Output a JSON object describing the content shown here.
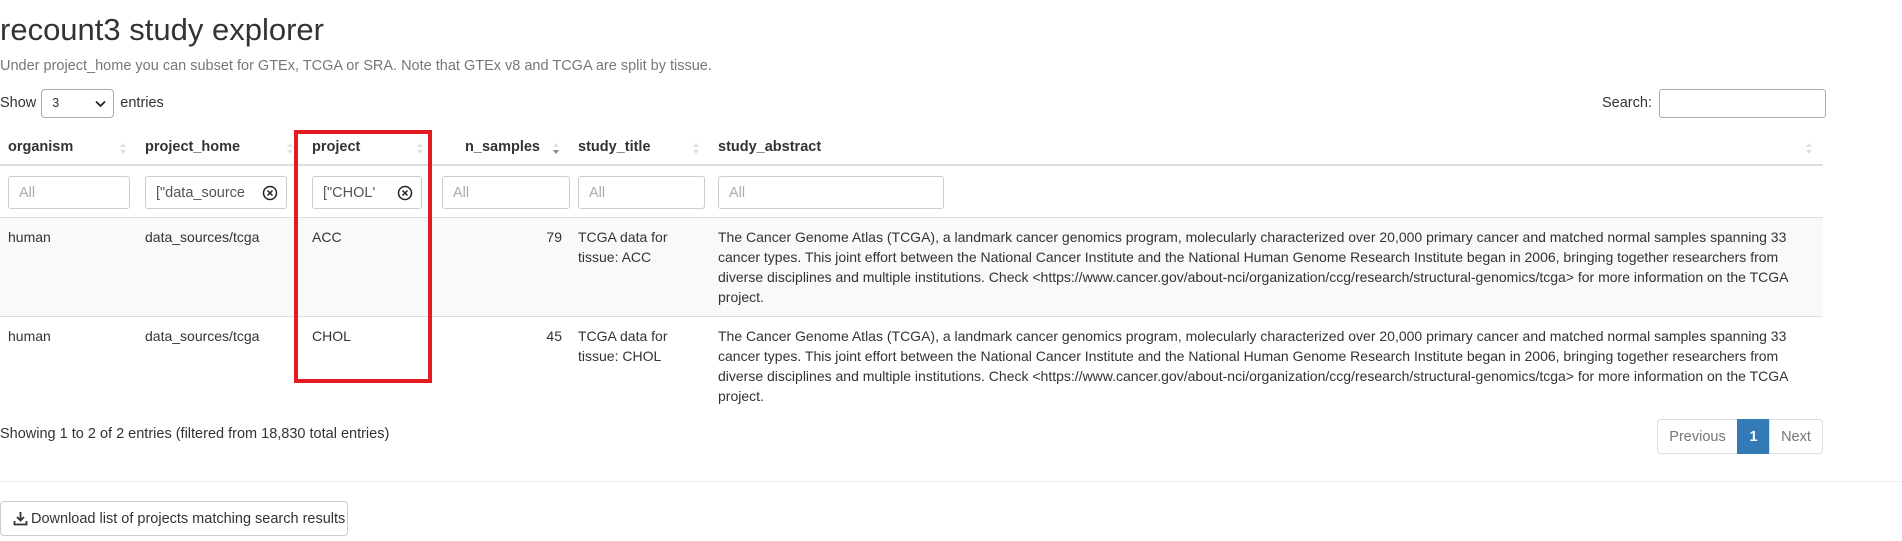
{
  "page": {
    "title": "recount3 study explorer",
    "subtitle": "Under project_home you can subset for GTEx, TCGA or SRA. Note that GTEx v8 and TCGA are split by tissue."
  },
  "length_control": {
    "show_label": "Show",
    "selected_value": "3",
    "entries_label": "entries"
  },
  "search": {
    "label": "Search:",
    "value": ""
  },
  "table": {
    "columns": [
      "organism",
      "project_home",
      "project",
      "n_samples",
      "study_title",
      "study_abstract"
    ],
    "filters": [
      {
        "value": "",
        "placeholder": "All"
      },
      {
        "value": "[\"data_source",
        "placeholder": "All"
      },
      {
        "value": "[\"CHOL'",
        "placeholder": "All"
      },
      {
        "value": "",
        "placeholder": "All"
      },
      {
        "value": "",
        "placeholder": "All"
      },
      {
        "value": "",
        "placeholder": "All"
      }
    ],
    "rows": [
      {
        "organism": "human",
        "project_home": "data_sources/tcga",
        "project": "ACC",
        "n_samples": "79",
        "study_title": "TCGA data for tissue: ACC",
        "study_abstract": "The Cancer Genome Atlas (TCGA), a landmark cancer genomics program, molecularly characterized over 20,000 primary cancer and matched normal samples spanning 33 cancer types. This joint effort between the National Cancer Institute and the National Human Genome Research Institute began in 2006, bringing together researchers from diverse disciplines and multiple institutions. Check <https://www.cancer.gov/about-nci/organization/ccg/research/structural-genomics/tcga> for more information on the TCGA project."
      },
      {
        "organism": "human",
        "project_home": "data_sources/tcga",
        "project": "CHOL",
        "n_samples": "45",
        "study_title": "TCGA data for tissue: CHOL",
        "study_abstract": "The Cancer Genome Atlas (TCGA), a landmark cancer genomics program, molecularly characterized over 20,000 primary cancer and matched normal samples spanning 33 cancer types. This joint effort between the National Cancer Institute and the National Human Genome Research Institute began in 2006, bringing together researchers from diverse disciplines and multiple institutions. Check <https://www.cancer.gov/about-nci/organization/ccg/research/structural-genomics/tcga> for more information on the TCGA project."
      }
    ]
  },
  "info": {
    "text": "Showing 1 to 2 of 2 entries (filtered from 18,830 total entries)"
  },
  "pagination": {
    "previous": "Previous",
    "current_page": "1",
    "next": "Next"
  },
  "download": {
    "label": "Download list of projects matching search results",
    "icon": "download-icon"
  },
  "colors": {
    "highlight": "#e31b23",
    "accent": "#337ab7"
  }
}
